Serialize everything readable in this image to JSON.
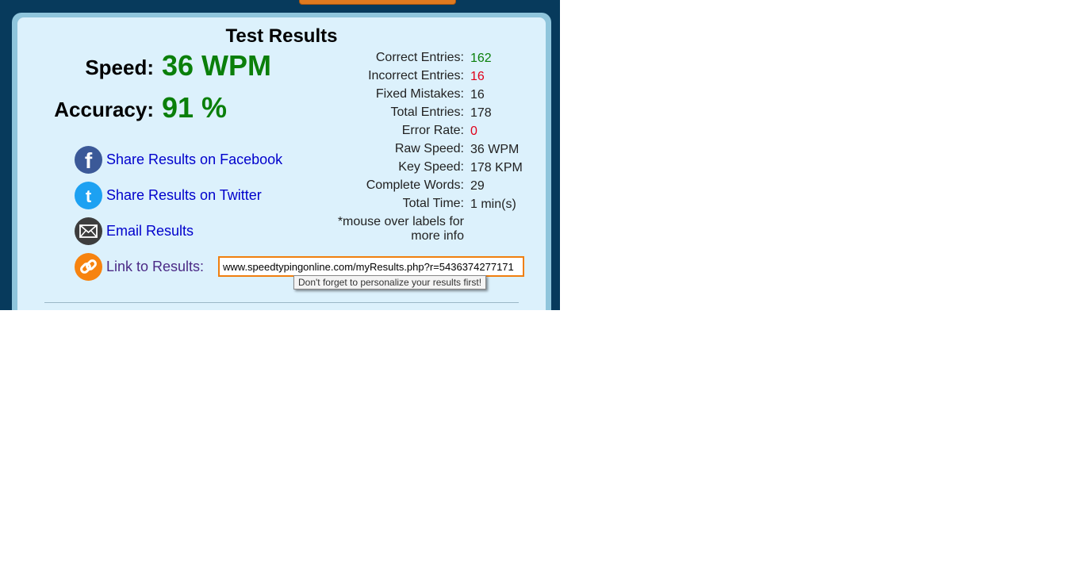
{
  "title": "Test Results",
  "speed": {
    "label": "Speed:",
    "value": "36 WPM"
  },
  "accuracy": {
    "label": "Accuracy:",
    "value": "91 %"
  },
  "share": {
    "facebook": "Share Results on Facebook",
    "twitter": "Share Results on Twitter",
    "email": "Email Results",
    "link_label": "Link to Results:",
    "link_value": "www.speedtypingonline.com/myResults.php?r=5436374277171",
    "tooltip": "Don't forget to personalize your results first!"
  },
  "stats": [
    {
      "label": "Correct Entries:",
      "value": "162",
      "color": "#0a7f0a"
    },
    {
      "label": "Incorrect Entries:",
      "value": "16",
      "color": "#e0001a"
    },
    {
      "label": "Fixed Mistakes:",
      "value": "16",
      "color": "#222222"
    },
    {
      "label": "Total Entries:",
      "value": "178",
      "color": "#222222"
    },
    {
      "label": "Error Rate:",
      "value": "0",
      "color": "#e0001a"
    },
    {
      "label": "Raw Speed:",
      "value": "36 WPM",
      "color": "#222222"
    },
    {
      "label": "Key Speed:",
      "value": "178 KPM",
      "color": "#222222"
    },
    {
      "label": "Complete Words:",
      "value": "29",
      "color": "#222222"
    },
    {
      "label": "Total Time:",
      "value": "1 min(s)",
      "color": "#222222"
    }
  ],
  "note_line1": "*mouse over labels for",
  "note_line2": "more info",
  "icons": {
    "facebook": "facebook-icon",
    "twitter": "twitter-icon",
    "email": "email-icon",
    "link": "link-icon"
  },
  "colors": {
    "background": "#073a5c",
    "panel": "#dcf1fc",
    "accent_green": "#0a7f0a",
    "accent_red": "#e0001a",
    "link_blue": "#0000cc",
    "input_border": "#f07f0f"
  }
}
